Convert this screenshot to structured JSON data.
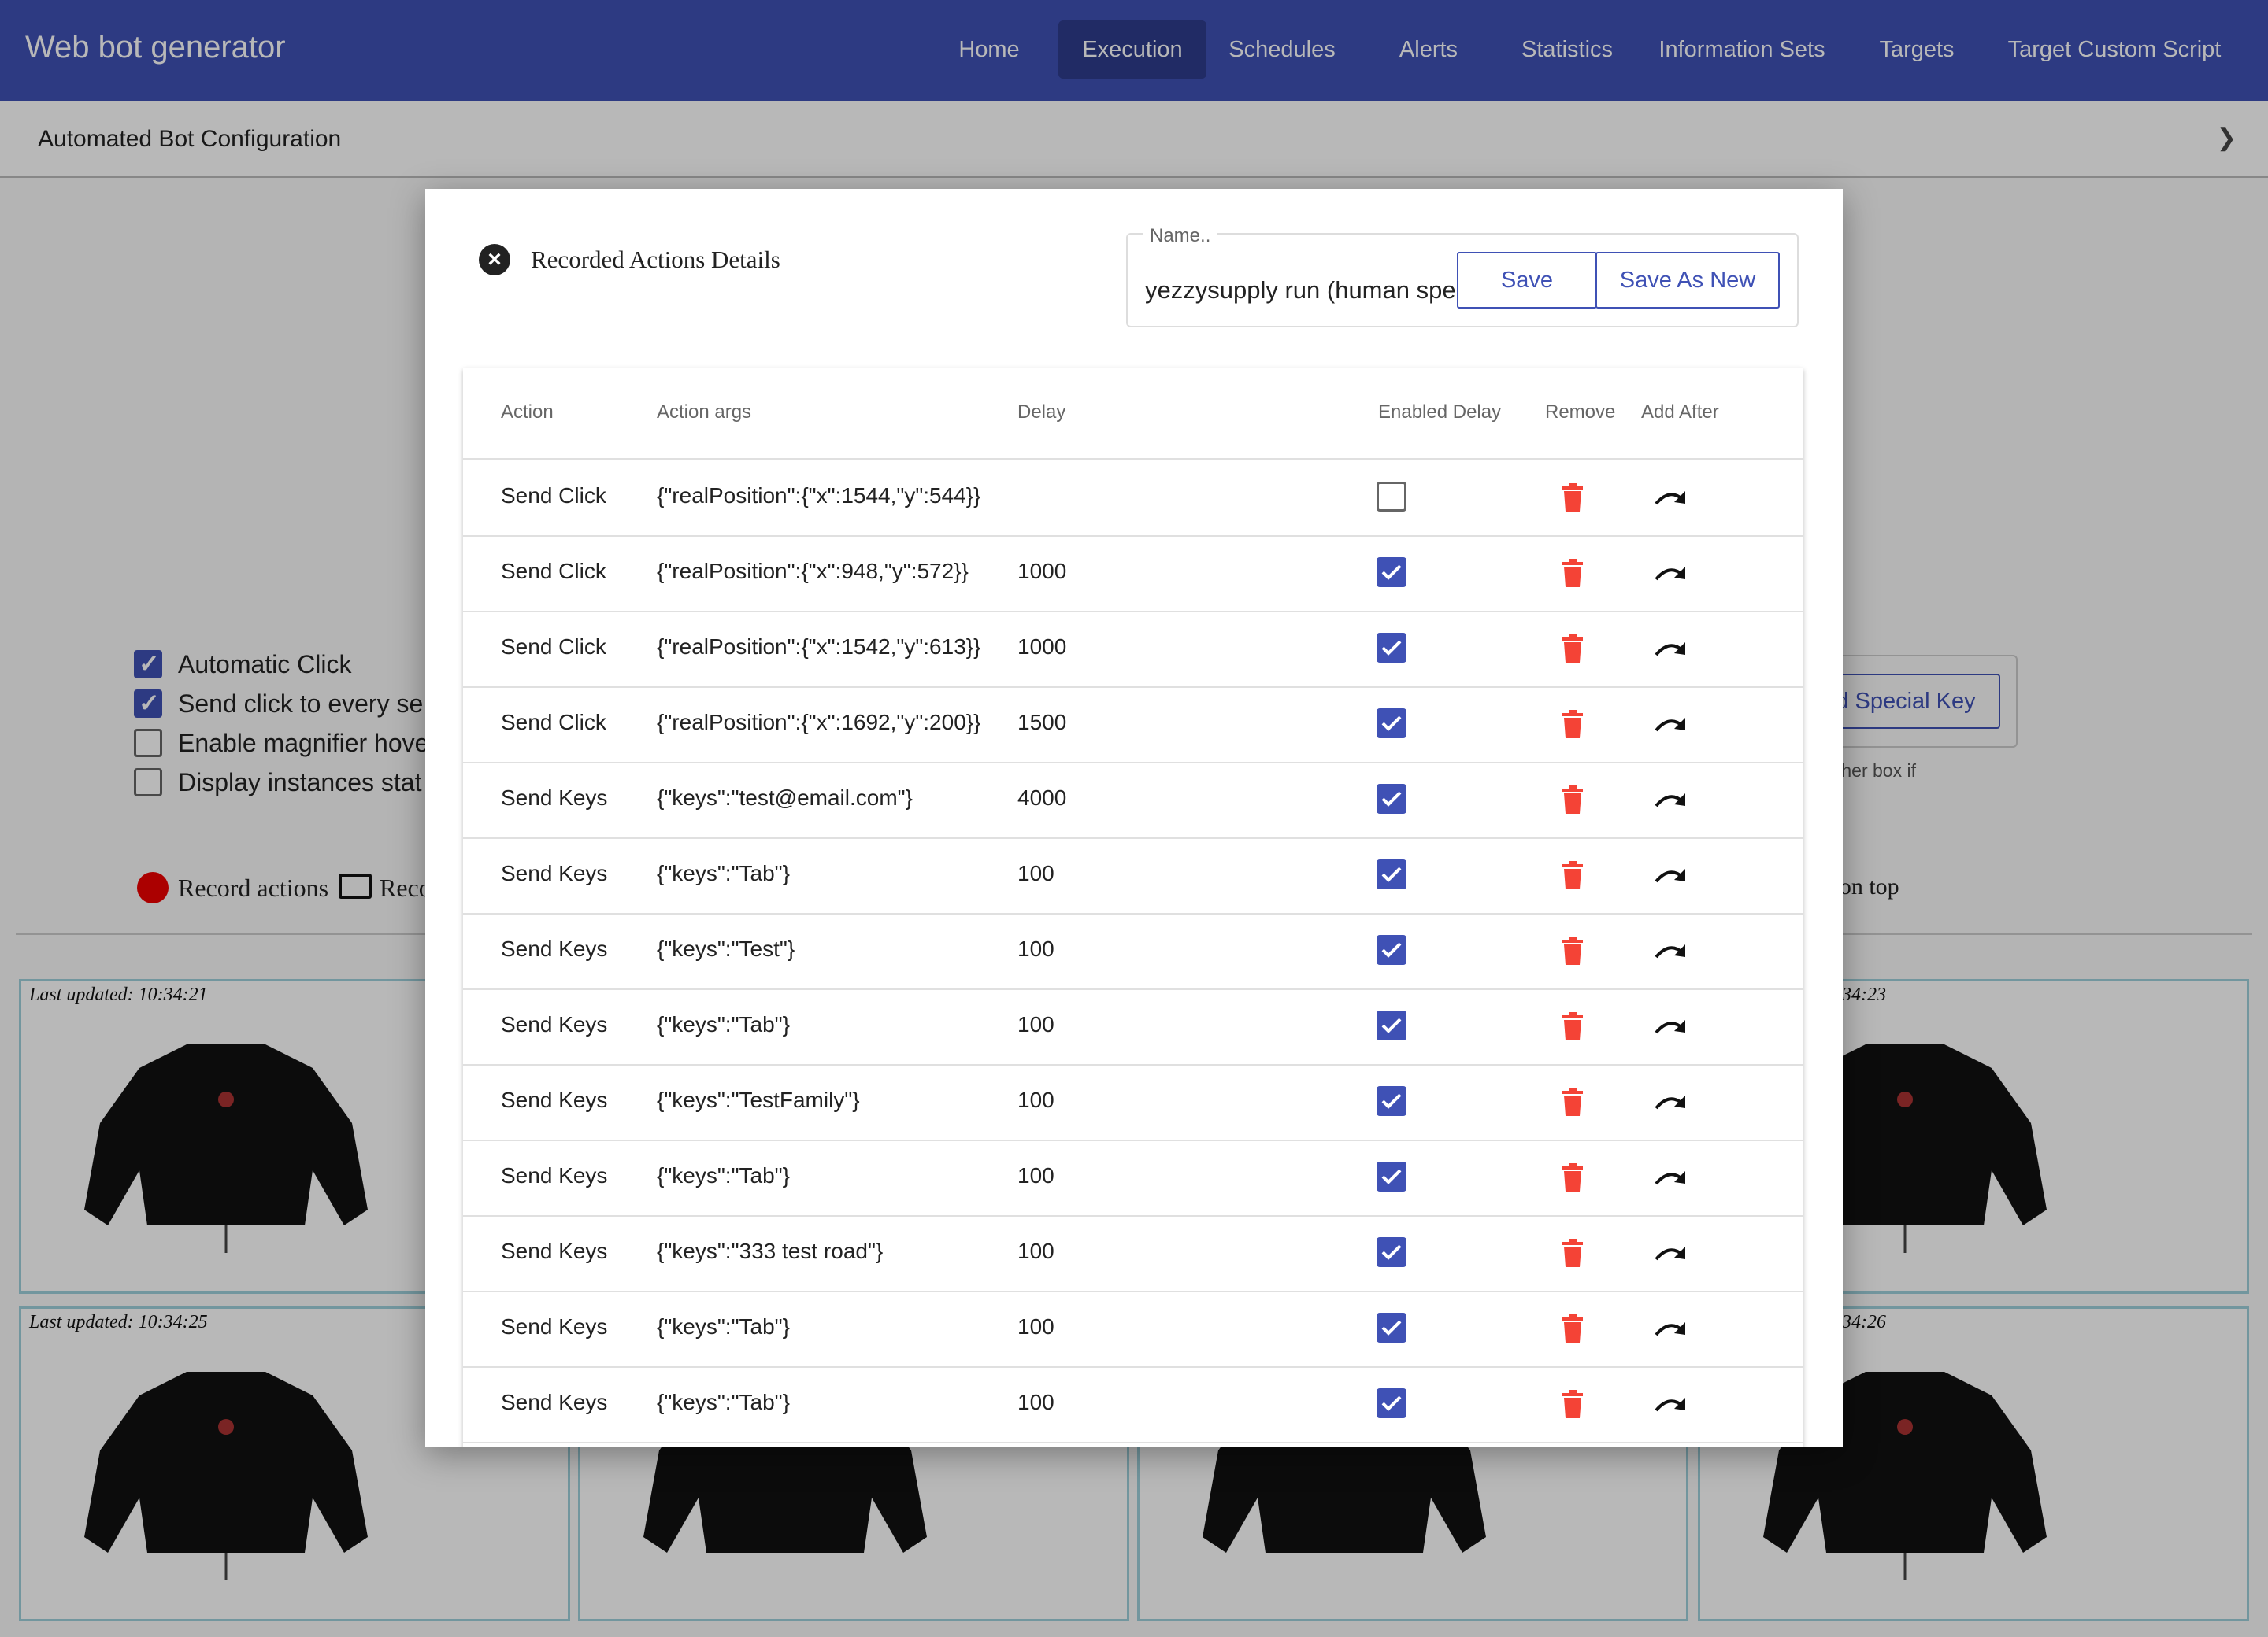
{
  "app": {
    "title": "Web bot generator",
    "nav": [
      "Home",
      "Execution",
      "Schedules",
      "Alerts",
      "Statistics",
      "Information Sets",
      "Targets",
      "Target Custom Script"
    ],
    "active_nav": "Execution"
  },
  "accordion": {
    "label": "Automated Bot Configuration",
    "chevron_icon": "chevron-down-icon"
  },
  "background": {
    "options": [
      {
        "label": "Automatic Click",
        "checked": true
      },
      {
        "label": "Send click to every se",
        "checked": true
      },
      {
        "label": "Enable magnifier hove",
        "checked": false
      },
      {
        "label": "Display instances stat",
        "checked": false
      }
    ],
    "record_label": "Record actions",
    "record2_label": "Reco",
    "right_button": "d Special Key",
    "right_hint": "e other box if",
    "right_label": "ge on top",
    "tiles": [
      {
        "timestamp": "Last updated: 10:34:21"
      },
      {
        "timestamp": "34:23"
      },
      {
        "timestamp": "Last updated: 10:34:25"
      },
      {
        "timestamp": "34:26"
      }
    ]
  },
  "modal": {
    "title": "Recorded Actions Details",
    "close_icon": "close-circle-icon",
    "name_label": "Name..",
    "name_value": "yezzysupply run (human spe",
    "save_label": "Save",
    "save_as_new_label": "Save As New",
    "columns": [
      "Action",
      "Action args",
      "Delay",
      "Enabled Delay",
      "Remove",
      "Add After"
    ],
    "rows": [
      {
        "action": "Send Click",
        "args": "{\"realPosition\":{\"x\":1544,\"y\":544}}",
        "delay": "",
        "enabled": false
      },
      {
        "action": "Send Click",
        "args": "{\"realPosition\":{\"x\":948,\"y\":572}}",
        "delay": "1000",
        "enabled": true
      },
      {
        "action": "Send Click",
        "args": "{\"realPosition\":{\"x\":1542,\"y\":613}}",
        "delay": "1000",
        "enabled": true
      },
      {
        "action": "Send Click",
        "args": "{\"realPosition\":{\"x\":1692,\"y\":200}}",
        "delay": "1500",
        "enabled": true
      },
      {
        "action": "Send Keys",
        "args": "{\"keys\":\"test@email.com\"}",
        "delay": "4000",
        "enabled": true
      },
      {
        "action": "Send Keys",
        "args": "{\"keys\":\"Tab\"}",
        "delay": "100",
        "enabled": true
      },
      {
        "action": "Send Keys",
        "args": "{\"keys\":\"Test\"}",
        "delay": "100",
        "enabled": true
      },
      {
        "action": "Send Keys",
        "args": "{\"keys\":\"Tab\"}",
        "delay": "100",
        "enabled": true
      },
      {
        "action": "Send Keys",
        "args": "{\"keys\":\"TestFamily\"}",
        "delay": "100",
        "enabled": true
      },
      {
        "action": "Send Keys",
        "args": "{\"keys\":\"Tab\"}",
        "delay": "100",
        "enabled": true
      },
      {
        "action": "Send Keys",
        "args": "{\"keys\":\"333 test road\"}",
        "delay": "100",
        "enabled": true
      },
      {
        "action": "Send Keys",
        "args": "{\"keys\":\"Tab\"}",
        "delay": "100",
        "enabled": true
      },
      {
        "action": "Send Keys",
        "args": "{\"keys\":\"Tab\"}",
        "delay": "100",
        "enabled": true
      }
    ],
    "remove_icon": "trash-icon",
    "add_after_icon": "redo-arrow-icon"
  }
}
